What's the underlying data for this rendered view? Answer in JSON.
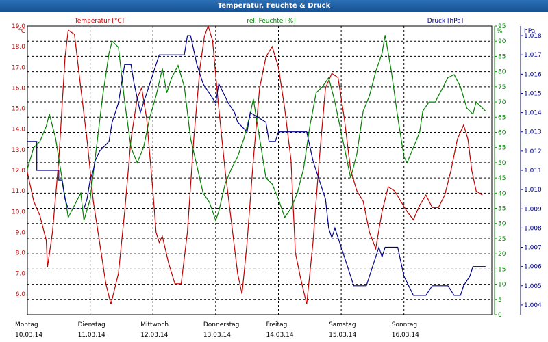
{
  "window": {
    "title": "Temperatur, Feuchte & Druck"
  },
  "chart_data": {
    "type": "line",
    "title": "Temperatur, Feuchte & Druck",
    "grid": true,
    "legend_placement": "top",
    "x_labels": [
      {
        "day": "Montag",
        "date": "10.03.14"
      },
      {
        "day": "Dienstag",
        "date": "11.03.14"
      },
      {
        "day": "Mittwoch",
        "date": "12.03.14"
      },
      {
        "day": "Donnerstag",
        "date": "13.03.14"
      },
      {
        "day": "Freitag",
        "date": "14.03.14"
      },
      {
        "day": "Samstag",
        "date": "15.03.14"
      },
      {
        "day": "Sonntag",
        "date": "16.03.14"
      }
    ],
    "x_range_days": [
      0,
      7.4
    ],
    "axes": {
      "temperature": {
        "unit": "°C",
        "color": "#c00000",
        "range": [
          5.0,
          19.0
        ],
        "ticks": [
          "6.0",
          "7.0",
          "8.0",
          "9.0",
          "10.0",
          "11.0",
          "12.0",
          "13.0",
          "14.0",
          "15.0",
          "16.0",
          "17.0",
          "18.0",
          "19.0"
        ]
      },
      "humidity": {
        "unit": "%",
        "color": "#008000",
        "range": [
          0,
          95
        ],
        "ticks": [
          "0",
          "5",
          "10",
          "15",
          "20",
          "25",
          "30",
          "35",
          "40",
          "45",
          "50",
          "55",
          "60",
          "65",
          "70",
          "75",
          "80",
          "85",
          "90",
          "95"
        ]
      },
      "pressure": {
        "unit": "hPa",
        "color": "#00008b",
        "range": [
          1.0035,
          1.0185
        ],
        "ticks": [
          "1.004",
          "1.005",
          "1.006",
          "1.007",
          "1.008",
          "1.009",
          "1.010",
          "1.011",
          "1.012",
          "1.013",
          "1.014",
          "1.015",
          "1.016",
          "1.017",
          "1.018"
        ]
      }
    },
    "series": [
      {
        "name": "Temperatur [°C]",
        "axis": "temperature",
        "color": "#c00000",
        "points": [
          [
            0.0,
            11.9
          ],
          [
            0.1,
            10.5
          ],
          [
            0.2,
            9.8
          ],
          [
            0.3,
            8.6
          ],
          [
            0.32,
            7.3
          ],
          [
            0.4,
            9.0
          ],
          [
            0.5,
            12.5
          ],
          [
            0.6,
            17.5
          ],
          [
            0.65,
            18.8
          ],
          [
            0.75,
            18.6
          ],
          [
            0.85,
            16.0
          ],
          [
            0.95,
            13.5
          ],
          [
            1.05,
            10.5
          ],
          [
            1.15,
            8.5
          ],
          [
            1.25,
            6.5
          ],
          [
            1.33,
            5.5
          ],
          [
            1.45,
            7.0
          ],
          [
            1.55,
            10.0
          ],
          [
            1.65,
            13.5
          ],
          [
            1.75,
            15.5
          ],
          [
            1.82,
            16.0
          ],
          [
            1.9,
            14.5
          ],
          [
            2.0,
            11.0
          ],
          [
            2.05,
            9.0
          ],
          [
            2.1,
            8.5
          ],
          [
            2.15,
            8.8
          ],
          [
            2.25,
            7.5
          ],
          [
            2.35,
            6.5
          ],
          [
            2.45,
            6.5
          ],
          [
            2.55,
            9.0
          ],
          [
            2.65,
            13.5
          ],
          [
            2.75,
            17.0
          ],
          [
            2.82,
            18.5
          ],
          [
            2.88,
            19.0
          ],
          [
            2.95,
            18.3
          ],
          [
            3.05,
            15.0
          ],
          [
            3.15,
            12.0
          ],
          [
            3.25,
            9.5
          ],
          [
            3.35,
            7.0
          ],
          [
            3.42,
            6.0
          ],
          [
            3.5,
            8.5
          ],
          [
            3.6,
            12.5
          ],
          [
            3.7,
            16.0
          ],
          [
            3.8,
            17.5
          ],
          [
            3.9,
            18.0
          ],
          [
            4.0,
            17.0
          ],
          [
            4.1,
            15.0
          ],
          [
            4.2,
            12.5
          ],
          [
            4.27,
            8.0
          ],
          [
            4.35,
            6.8
          ],
          [
            4.45,
            5.5
          ],
          [
            4.55,
            8.5
          ],
          [
            4.65,
            12.5
          ],
          [
            4.75,
            16.0
          ],
          [
            4.85,
            16.7
          ],
          [
            4.95,
            16.5
          ],
          [
            5.05,
            14.5
          ],
          [
            5.15,
            12.0
          ],
          [
            5.25,
            11.0
          ],
          [
            5.35,
            10.5
          ],
          [
            5.45,
            9.0
          ],
          [
            5.55,
            8.2
          ],
          [
            5.65,
            10.0
          ],
          [
            5.75,
            11.2
          ],
          [
            5.85,
            11.0
          ],
          [
            5.95,
            10.5
          ],
          [
            6.05,
            10.0
          ],
          [
            6.15,
            9.6
          ],
          [
            6.25,
            10.3
          ],
          [
            6.35,
            10.8
          ],
          [
            6.45,
            10.2
          ],
          [
            6.55,
            10.2
          ],
          [
            6.65,
            10.8
          ],
          [
            6.75,
            12.0
          ],
          [
            6.85,
            13.5
          ],
          [
            6.95,
            14.2
          ],
          [
            7.02,
            13.5
          ],
          [
            7.08,
            12.0
          ],
          [
            7.15,
            11.0
          ],
          [
            7.25,
            10.8
          ]
        ]
      },
      {
        "name": "rel. Feuchte [%]",
        "axis": "humidity",
        "color": "#008000",
        "points": [
          [
            0.0,
            48
          ],
          [
            0.1,
            55
          ],
          [
            0.2,
            57
          ],
          [
            0.3,
            62
          ],
          [
            0.35,
            66
          ],
          [
            0.45,
            58
          ],
          [
            0.55,
            45
          ],
          [
            0.65,
            32
          ],
          [
            0.75,
            36
          ],
          [
            0.85,
            40
          ],
          [
            0.9,
            31
          ],
          [
            1.0,
            38
          ],
          [
            1.1,
            55
          ],
          [
            1.2,
            72
          ],
          [
            1.3,
            86
          ],
          [
            1.35,
            90
          ],
          [
            1.45,
            88
          ],
          [
            1.55,
            70
          ],
          [
            1.65,
            55
          ],
          [
            1.75,
            50
          ],
          [
            1.85,
            55
          ],
          [
            1.95,
            65
          ],
          [
            2.05,
            72
          ],
          [
            2.15,
            81
          ],
          [
            2.22,
            73
          ],
          [
            2.3,
            78
          ],
          [
            2.4,
            82
          ],
          [
            2.5,
            75
          ],
          [
            2.6,
            58
          ],
          [
            2.7,
            49
          ],
          [
            2.8,
            40
          ],
          [
            2.9,
            37
          ],
          [
            3.0,
            31
          ],
          [
            3.05,
            34
          ],
          [
            3.15,
            43
          ],
          [
            3.25,
            48
          ],
          [
            3.35,
            52
          ],
          [
            3.45,
            58
          ],
          [
            3.55,
            66
          ],
          [
            3.6,
            71
          ],
          [
            3.7,
            58
          ],
          [
            3.8,
            45
          ],
          [
            3.9,
            43
          ],
          [
            4.0,
            38
          ],
          [
            4.1,
            32
          ],
          [
            4.2,
            35
          ],
          [
            4.3,
            40
          ],
          [
            4.4,
            48
          ],
          [
            4.5,
            62
          ],
          [
            4.6,
            73
          ],
          [
            4.7,
            75
          ],
          [
            4.8,
            78
          ],
          [
            4.9,
            70
          ],
          [
            5.0,
            60
          ],
          [
            5.1,
            50
          ],
          [
            5.15,
            45
          ],
          [
            5.25,
            53
          ],
          [
            5.35,
            67
          ],
          [
            5.45,
            72
          ],
          [
            5.55,
            80
          ],
          [
            5.65,
            86
          ],
          [
            5.7,
            92
          ],
          [
            5.8,
            80
          ],
          [
            5.9,
            65
          ],
          [
            6.0,
            52
          ],
          [
            6.05,
            50
          ],
          [
            6.15,
            55
          ],
          [
            6.25,
            60
          ],
          [
            6.3,
            67
          ],
          [
            6.4,
            70
          ],
          [
            6.5,
            70
          ],
          [
            6.6,
            74
          ],
          [
            6.7,
            78
          ],
          [
            6.8,
            79
          ],
          [
            6.9,
            75
          ],
          [
            7.0,
            68
          ],
          [
            7.1,
            66
          ],
          [
            7.15,
            70
          ],
          [
            7.2,
            69
          ],
          [
            7.3,
            67
          ]
        ]
      },
      {
        "name": "Druck [hPa]",
        "axis": "pressure",
        "color": "#00008b",
        "points": [
          [
            0.0,
            1.0125
          ],
          [
            0.15,
            1.0125
          ],
          [
            0.15,
            1.011
          ],
          [
            0.5,
            1.011
          ],
          [
            0.5,
            1.0105
          ],
          [
            0.55,
            1.0105
          ],
          [
            0.6,
            1.0095
          ],
          [
            0.65,
            1.009
          ],
          [
            0.9,
            1.009
          ],
          [
            0.95,
            1.0095
          ],
          [
            1.0,
            1.0105
          ],
          [
            1.05,
            1.011
          ],
          [
            1.08,
            1.0115
          ],
          [
            1.15,
            1.012
          ],
          [
            1.3,
            1.0125
          ],
          [
            1.35,
            1.0135
          ],
          [
            1.45,
            1.0145
          ],
          [
            1.5,
            1.0155
          ],
          [
            1.55,
            1.0165
          ],
          [
            1.65,
            1.0165
          ],
          [
            1.7,
            1.0155
          ],
          [
            1.8,
            1.014
          ],
          [
            1.9,
            1.015
          ],
          [
            2.05,
            1.0165
          ],
          [
            2.1,
            1.017
          ],
          [
            2.5,
            1.017
          ],
          [
            2.55,
            1.018
          ],
          [
            2.6,
            1.018
          ],
          [
            2.7,
            1.0165
          ],
          [
            2.8,
            1.0155
          ],
          [
            2.9,
            1.015
          ],
          [
            3.0,
            1.0145
          ],
          [
            3.05,
            1.0155
          ],
          [
            3.2,
            1.0145
          ],
          [
            3.3,
            1.014
          ],
          [
            3.35,
            1.0135
          ],
          [
            3.5,
            1.013
          ],
          [
            3.55,
            1.014
          ],
          [
            3.8,
            1.0135
          ],
          [
            3.85,
            1.0125
          ],
          [
            3.95,
            1.0125
          ],
          [
            4.0,
            1.013
          ],
          [
            4.45,
            1.013
          ],
          [
            4.55,
            1.0115
          ],
          [
            4.65,
            1.0105
          ],
          [
            4.75,
            1.0095
          ],
          [
            4.8,
            1.008
          ],
          [
            4.85,
            1.0075
          ],
          [
            4.9,
            1.008
          ],
          [
            4.95,
            1.0075
          ],
          [
            5.0,
            1.007
          ],
          [
            5.05,
            1.0065
          ],
          [
            5.1,
            1.006
          ],
          [
            5.2,
            1.005
          ],
          [
            5.4,
            1.005
          ],
          [
            5.5,
            1.006
          ],
          [
            5.6,
            1.007
          ],
          [
            5.65,
            1.0065
          ],
          [
            5.7,
            1.007
          ],
          [
            5.9,
            1.007
          ],
          [
            6.0,
            1.0055
          ],
          [
            6.15,
            1.0045
          ],
          [
            6.35,
            1.0045
          ],
          [
            6.45,
            1.005
          ],
          [
            6.7,
            1.005
          ],
          [
            6.8,
            1.0045
          ],
          [
            6.9,
            1.0045
          ],
          [
            6.95,
            1.005
          ],
          [
            7.05,
            1.0055
          ],
          [
            7.1,
            1.006
          ],
          [
            7.3,
            1.006
          ]
        ]
      }
    ]
  }
}
